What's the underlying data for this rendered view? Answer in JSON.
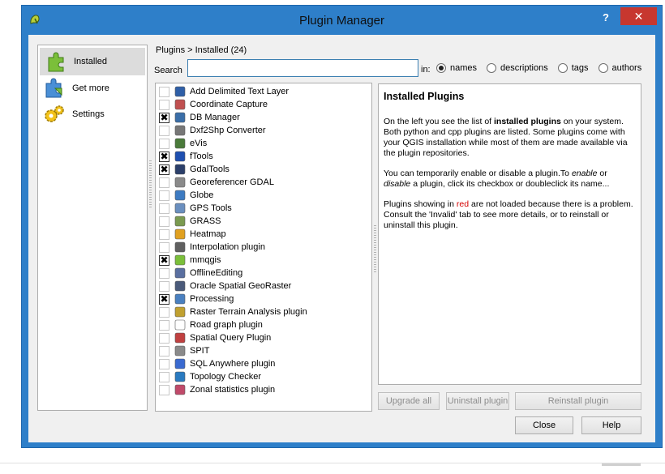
{
  "window": {
    "title": "Plugin Manager",
    "help_label": "?",
    "close_label": "✕"
  },
  "nav": {
    "items": [
      {
        "label": "Installed",
        "icon": "puzzle-installed-icon",
        "selected": true
      },
      {
        "label": "Get more",
        "icon": "puzzle-get-more-icon",
        "selected": false
      },
      {
        "label": "Settings",
        "icon": "gears-settings-icon",
        "selected": false
      }
    ]
  },
  "breadcrumb": "Plugins > Installed (24)",
  "search": {
    "label": "Search",
    "value": "",
    "in_label": "in:",
    "options": [
      {
        "label": "names",
        "selected": true
      },
      {
        "label": "descriptions",
        "selected": false
      },
      {
        "label": "tags",
        "selected": false
      },
      {
        "label": "authors",
        "selected": false
      }
    ]
  },
  "plugins": [
    {
      "name": "Add Delimited Text Layer",
      "checked": false,
      "icon": "delimited-text-icon",
      "color": "#2f5fa7"
    },
    {
      "name": "Coordinate Capture",
      "checked": false,
      "icon": "crosshair-icon",
      "color": "#c05050"
    },
    {
      "name": "DB Manager",
      "checked": true,
      "icon": "database-icon",
      "color": "#3a6ea8"
    },
    {
      "name": "Dxf2Shp Converter",
      "checked": false,
      "icon": "dxf-icon",
      "color": "#777777"
    },
    {
      "name": "eVis",
      "checked": false,
      "icon": "evis-icon",
      "color": "#4a7a3a"
    },
    {
      "name": "fTools",
      "checked": true,
      "icon": "ftools-icon",
      "color": "#1e4fb0"
    },
    {
      "name": "GdalTools",
      "checked": true,
      "icon": "gdal-icon",
      "color": "#2b3f6a"
    },
    {
      "name": "Georeferencer GDAL",
      "checked": false,
      "icon": "georeferencer-icon",
      "color": "#8a8a8a"
    },
    {
      "name": "Globe",
      "checked": false,
      "icon": "globe-icon",
      "color": "#3d7bc2"
    },
    {
      "name": "GPS Tools",
      "checked": false,
      "icon": "gps-icon",
      "color": "#6a8fbf"
    },
    {
      "name": "GRASS",
      "checked": false,
      "icon": "grass-icon",
      "color": "#7a9a50"
    },
    {
      "name": "Heatmap",
      "checked": false,
      "icon": "heatmap-icon",
      "color": "#e0a020"
    },
    {
      "name": "Interpolation plugin",
      "checked": false,
      "icon": "interpolation-icon",
      "color": "#606060"
    },
    {
      "name": "mmqgis",
      "checked": true,
      "icon": "puzzle-icon",
      "color": "#7bbf3a"
    },
    {
      "name": "OfflineEditing",
      "checked": false,
      "icon": "offline-editing-icon",
      "color": "#5a6fa0"
    },
    {
      "name": "Oracle Spatial GeoRaster",
      "checked": false,
      "icon": "oracle-icon",
      "color": "#4a5a7a"
    },
    {
      "name": "Processing",
      "checked": true,
      "icon": "gear-icon",
      "color": "#4a80c0"
    },
    {
      "name": "Raster Terrain Analysis plugin",
      "checked": false,
      "icon": "terrain-icon",
      "color": "#c0a030"
    },
    {
      "name": "Road graph plugin",
      "checked": false,
      "icon": "road-graph-icon",
      "color": "#ffffff"
    },
    {
      "name": "Spatial Query Plugin",
      "checked": false,
      "icon": "spatial-query-icon",
      "color": "#c04040"
    },
    {
      "name": "SPIT",
      "checked": false,
      "icon": "spit-icon",
      "color": "#8a8a8a"
    },
    {
      "name": "SQL Anywhere plugin",
      "checked": false,
      "icon": "sql-anywhere-icon",
      "color": "#3a6ad0"
    },
    {
      "name": "Topology Checker",
      "checked": false,
      "icon": "topology-icon",
      "color": "#2a7ac0"
    },
    {
      "name": "Zonal statistics plugin",
      "checked": false,
      "icon": "zonal-stats-icon",
      "color": "#c04a6a"
    }
  ],
  "info": {
    "heading": "Installed Plugins",
    "p1_a": "On the left you see the list of ",
    "p1_b": "installed plugins",
    "p1_c": " on your system. Both python and cpp plugins are listed. Some plugins come with your QGIS installation while most of them are made available via the plugin repositories.",
    "p2_a": "You can temporarily enable or disable a plugin.To ",
    "p2_b": "enable",
    "p2_c": " or ",
    "p2_d": "disable",
    "p2_e": " a plugin, click its checkbox or doubleclick its name...",
    "p3_a": "Plugins showing in ",
    "p3_b": "red",
    "p3_c": " are not loaded because there is a problem. Consult the 'Invalid' tab to see more details, or to reinstall or uninstall this plugin."
  },
  "buttons": {
    "upgrade_all": "Upgrade all",
    "uninstall": "Uninstall plugin",
    "reinstall": "Reinstall plugin",
    "close": "Close",
    "help": "Help"
  },
  "colors": {
    "titlebar": "#2e7fc9",
    "close_button": "#c7372f",
    "accent_input_border": "#3c7fb1"
  }
}
